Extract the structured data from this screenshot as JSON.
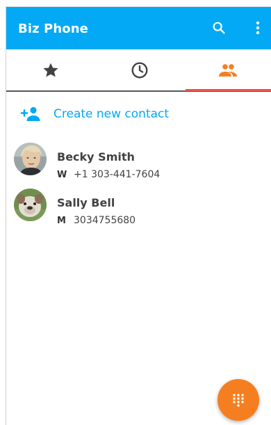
{
  "app": {
    "title": "Biz Phone"
  },
  "colors": {
    "accent": "#03a9f4",
    "active_tab": "#f57f20",
    "indicator": "#ef5350",
    "fab": "#f57f20"
  },
  "tabs": [
    {
      "name": "favorites",
      "icon": "star-icon"
    },
    {
      "name": "recents",
      "icon": "clock-icon"
    },
    {
      "name": "contacts",
      "icon": "people-icon",
      "active": true
    }
  ],
  "create_contact": {
    "label": "Create new contact",
    "icon": "add-person-icon"
  },
  "contacts": [
    {
      "name": "Becky Smith",
      "phone_type": "W",
      "phone": "+1 303-441-7604"
    },
    {
      "name": "Sally Bell",
      "phone_type": "M",
      "phone": "3034755680"
    }
  ],
  "fab": {
    "icon": "dialpad-icon"
  }
}
